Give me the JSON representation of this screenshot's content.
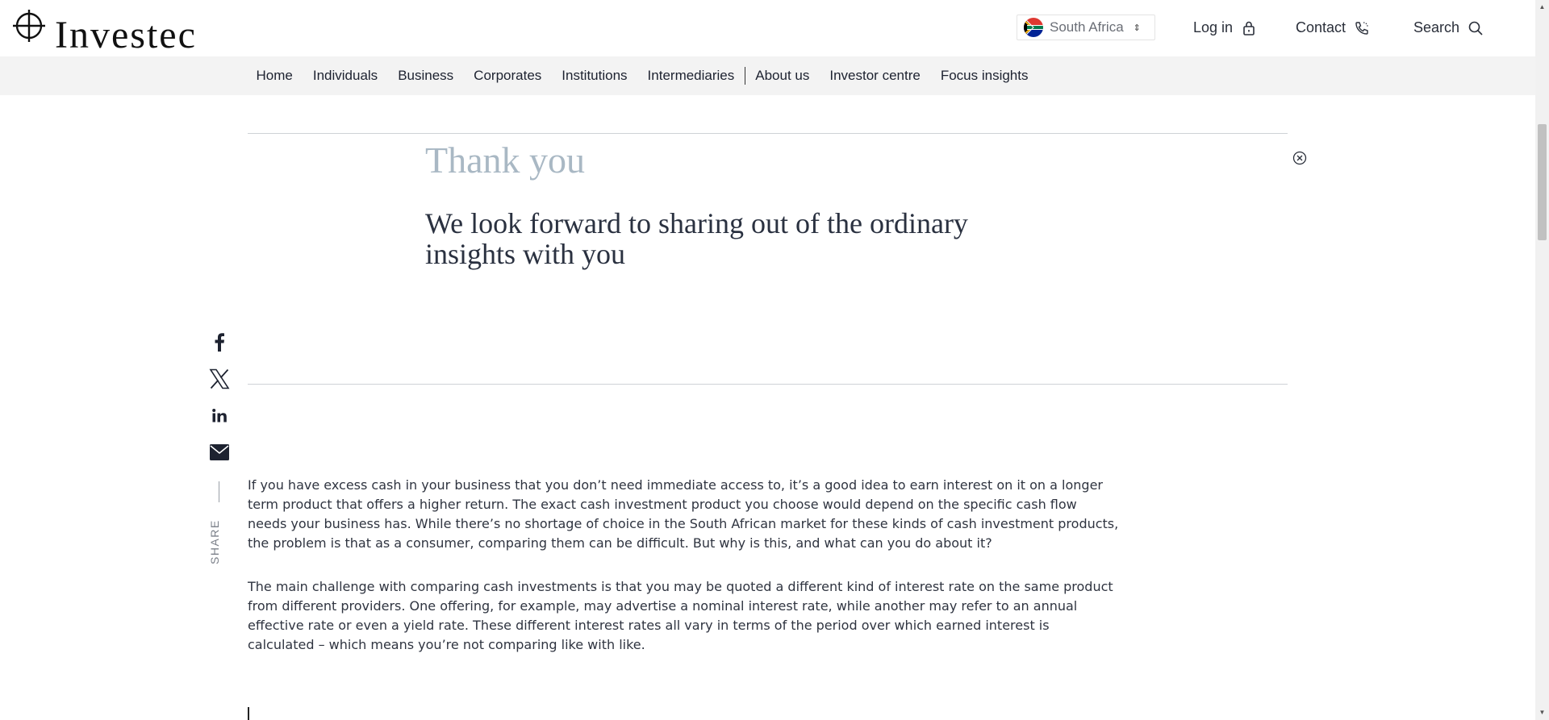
{
  "header": {
    "brand": "Investec",
    "country": {
      "label": "South Africa",
      "flag": "south-africa-flag"
    },
    "login_label": "Log in",
    "contact_label": "Contact",
    "search_label": "Search"
  },
  "nav": {
    "items": [
      "Home",
      "Individuals",
      "Business",
      "Corporates",
      "Institutions",
      "Intermediaries",
      "About us",
      "Investor centre",
      "Focus insights"
    ]
  },
  "thanks": {
    "title": "Thank you",
    "subtitle": "We look forward to sharing out of the ordinary insights with you"
  },
  "share": {
    "label": "SHARE",
    "icons": [
      "facebook-icon",
      "x-icon",
      "linkedin-icon",
      "email-icon"
    ]
  },
  "article": {
    "paragraphs": [
      "If you have excess cash in your business that you don’t need immediate access to, it’s a good idea to earn interest on it on a longer term product that offers a higher return. The exact cash investment product you choose would depend on the specific cash flow needs your business has. While there’s no shortage of choice in the South African market for these kinds of cash investment products, the problem is that as a consumer, comparing them can be difficult. But why is this, and what can you do about it?",
      "The main challenge with comparing cash investments is that you may be quoted a different kind of interest rate on the same product from different providers. One offering, for example, may advertise a nominal interest rate, while another may refer to an annual effective rate or even a yield rate. These different interest rates all vary in terms of the period over which earned interest is calculated – which means you’re not comparing like with like."
    ]
  },
  "colors": {
    "nav_bg": "#f3f3f3",
    "thanks_title": "#a9b8c4",
    "text": "#2a2f3a"
  }
}
